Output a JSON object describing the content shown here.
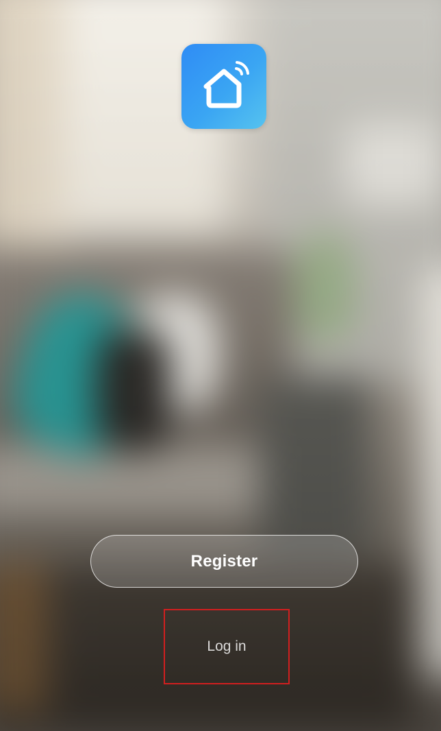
{
  "app": {
    "logo_icon": "smart-home-house-wifi-icon",
    "logo_gradient": [
      "#2f8cf5",
      "#56c3ef"
    ]
  },
  "actions": {
    "register_label": "Register",
    "login_label": "Log in"
  },
  "colors": {
    "highlight_border": "#d21f1f",
    "button_text": "#ffffff"
  }
}
